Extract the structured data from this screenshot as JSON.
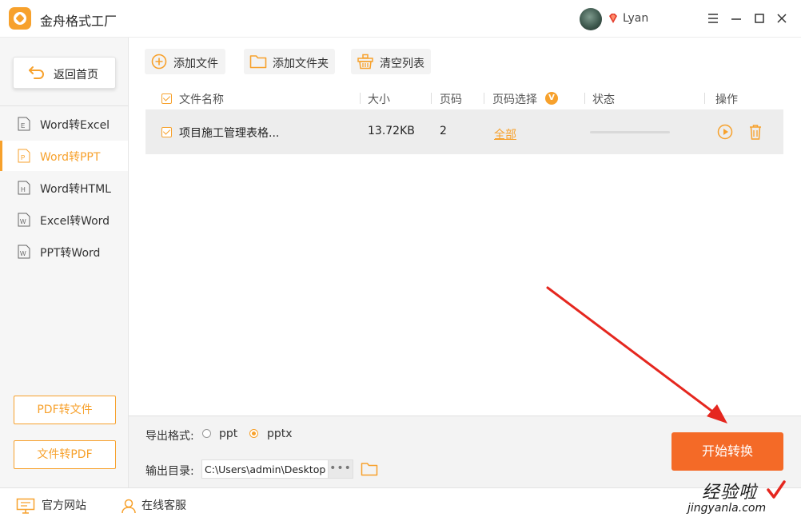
{
  "app": {
    "title": "金舟格式工厂"
  },
  "user": {
    "name": "Lyan"
  },
  "sidebar": {
    "home_label": "返回首页",
    "items": [
      {
        "label": "Word转Excel",
        "icon_letter": "E",
        "active": false
      },
      {
        "label": "Word转PPT",
        "icon_letter": "P",
        "active": true
      },
      {
        "label": "Word转HTML",
        "icon_letter": "H",
        "active": false
      },
      {
        "label": "Excel转Word",
        "icon_letter": "W",
        "active": false
      },
      {
        "label": "PPT转Word",
        "icon_letter": "W",
        "active": false
      }
    ],
    "pdf_to_file": "PDF转文件",
    "file_to_pdf": "文件转PDF"
  },
  "toolbar": {
    "add_file": "添加文件",
    "add_folder": "添加文件夹",
    "clear_list": "清空列表"
  },
  "table": {
    "headers": {
      "name": "文件名称",
      "size": "大小",
      "pages": "页码",
      "page_select": "页码选择",
      "status": "状态",
      "actions": "操作"
    },
    "page_select_badge": "V",
    "rows": [
      {
        "name": "项目施工管理表格...",
        "size": "13.72KB",
        "pages": "2",
        "page_select": "全部",
        "checked": true,
        "progress": 0
      }
    ]
  },
  "export": {
    "format_label": "导出格式:",
    "options": [
      {
        "label": "ppt",
        "selected": false
      },
      {
        "label": "pptx",
        "selected": true
      }
    ],
    "dir_label": "输出目录:",
    "dir_value": "C:\\Users\\admin\\Desktop",
    "browse_label": "•••",
    "start_label": "开始转换"
  },
  "statusbar": {
    "website": "官方网站",
    "support": "在线客服"
  },
  "watermark": {
    "cn": "经验啦",
    "en": "jingyanla.com"
  },
  "colors": {
    "accent": "#f7a12c",
    "start_button": "#f46a27",
    "annotation_arrow": "#e5271f"
  }
}
